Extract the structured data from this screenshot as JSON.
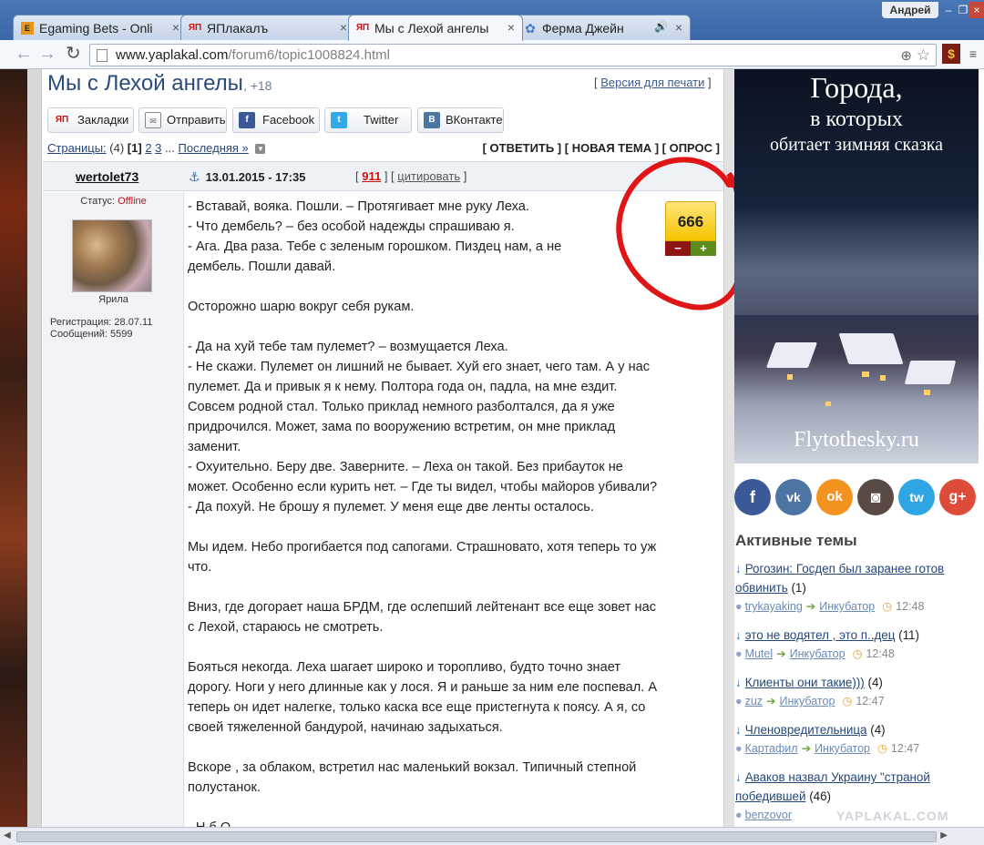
{
  "browser": {
    "user": "Андрей",
    "tabs": [
      {
        "label": "Egaming Bets - Onli",
        "favicon": "E"
      },
      {
        "label": "ЯПлакалъ",
        "favicon": "ЯП"
      },
      {
        "label": "Мы с Лехой ангелы",
        "favicon": "ЯП"
      },
      {
        "label": "Ферма Джейн",
        "favicon": "✿"
      }
    ],
    "url_host": "www.yaplakal.com",
    "url_path": "/forum6/topic1008824.html"
  },
  "topic": {
    "title": "Мы с Лехой ангелы",
    "age": ", +18",
    "print_link": "Версия для печати",
    "share": {
      "bookmarks": "Закладки",
      "send": "Отправить",
      "facebook": "Facebook",
      "twitter": "Twitter",
      "vk": "ВКонтакте"
    },
    "pages_label": "Страницы:",
    "pages_count": "(4)",
    "page_current": "[1]",
    "page_2": "2",
    "page_3": "3",
    "ellipsis": "...",
    "last_page": "Последняя »",
    "actions": "[ ОТВЕТИТЬ ] [ НОВАЯ ТЕМА ] [ ОПРОС ]"
  },
  "post": {
    "author": "wertolet73",
    "date": "13.01.2015 - 17:35",
    "number": "911",
    "cite": "цитировать",
    "status_label": "Статус:",
    "status_value": "Offline",
    "avatar_name": "Ярила",
    "reg": "Регистрация: 28.07.11",
    "posts": "Сообщений: 5599",
    "rating": "666",
    "lines": [
      "- Вставай, вояка. Пошли. – Протягивает мне руку Леха.",
      "- Что дембель? – без особой надежды спрашиваю я.",
      "- Ага. Два раза. Тебе с зеленым горошком. Пиздец нам, а не",
      "дембель. Пошли давай.",
      "",
      "Осторожно шарю вокруг себя рукам.",
      "",
      "- Да на хуй тебе там пулемет? – возмущается Леха.",
      "- Не скажи. Пулемет он лишний не бывает. Хуй его знает, чего там. А у нас",
      "пулемет. Да и привык я к нему. Полтора года он, падла, на мне ездит.",
      "Совсем родной стал. Только приклад немного разболтался, да я уже",
      "придрочился. Может, зама по вооружению встретим, он мне приклад",
      "заменит.",
      "- Охуительно. Беру две. Заверните. – Леха он такой. Без прибауток не",
      "может. Особенно если курить нет. – Где ты видел, чтобы майоров убивали?",
      "- Да похуй. Не брошу я пулемет. У меня еще две ленты осталось.",
      "",
      "Мы идем. Небо прогибается под сапогами. Страшновато, хотя теперь то уж",
      "что.",
      "",
      "Вниз, где догорает наша БРДМ, где ослепший лейтенант все еще зовет нас",
      "с Лехой, стараюсь не смотреть.",
      "",
      "Бояться некогда. Леха шагает широко и торопливо, будто точно знает",
      "дорогу. Ноги у него длинные как у лося. Я и раньше за ним еле поспевал. А",
      "теперь он идет налегке, только каска все еще пристегнута к поясу. А я, со",
      "своей тяжеленной бандурой, начинаю задыхаться.",
      "",
      "Вскоре , за облаком, встретил нас маленький вокзал. Типичный степной",
      "полустанок.",
      "",
      "- Н                  б           О"
    ]
  },
  "ad": {
    "line1": "Города,",
    "line2": "в которых",
    "line3": "обитает зимняя сказка",
    "site": "Flytothesky.ru"
  },
  "social": [
    "f",
    "vk",
    "ok",
    "◙",
    "tw",
    "g+"
  ],
  "active": {
    "title": "Активные темы",
    "topics": [
      {
        "title": "Рогозин: Госдеп был заранее готов обвинить",
        "count": "(1)",
        "user": "trykayaking",
        "section": "Инкубатор",
        "time": "12:48"
      },
      {
        "title": "это не водятел , это п..дец",
        "count": "(11)",
        "user": "Mutel",
        "section": "Инкубатор",
        "time": "12:48"
      },
      {
        "title": "Клиенты они такие)))",
        "count": "(4)",
        "user": "zuz",
        "section": "Инкубатор",
        "time": "12:47"
      },
      {
        "title": "Членовредительница",
        "count": "(4)",
        "user": "Картафил",
        "section": "Инкубатор",
        "time": "12:47"
      },
      {
        "title": "Аваков назвал Украину \"страной победившей",
        "count": "(46)",
        "user": "benzovor",
        "section": "",
        "time": ""
      }
    ]
  },
  "watermark": "YAPLAKAL.COM",
  "colors": {
    "link": "#24477a",
    "accent_red": "#e01515",
    "rating_bg": "#f6c400"
  }
}
